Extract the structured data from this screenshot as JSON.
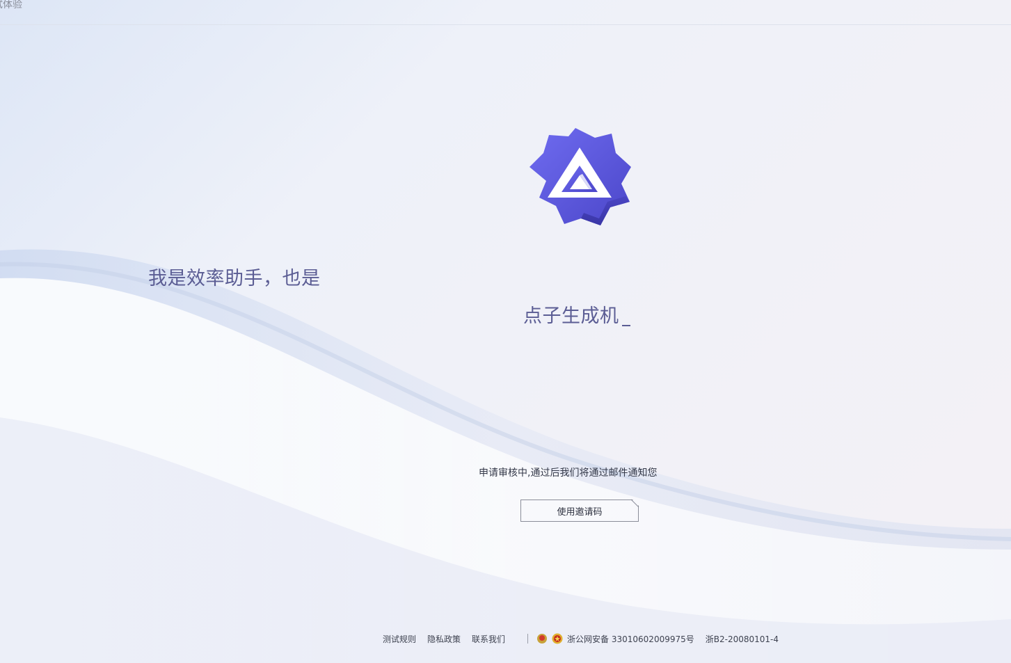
{
  "header": {
    "title": "试体验"
  },
  "hero": {
    "logo_icon": "tongyi-star-triangle-icon",
    "line1": "我是效率助手，也是",
    "line2": "点子生成机"
  },
  "status": {
    "message": "申请审核中,通过后我们将通过邮件通知您"
  },
  "actions": {
    "invite_label": "使用邀请码"
  },
  "footer": {
    "links": [
      "测试规则",
      "隐私政策",
      "联系我们"
    ],
    "police_record": "浙公网安备 33010602009975号",
    "icp": "浙B2-20080101-4"
  },
  "colors": {
    "brand": "#5b58d6",
    "headline": "#5b5d94"
  }
}
